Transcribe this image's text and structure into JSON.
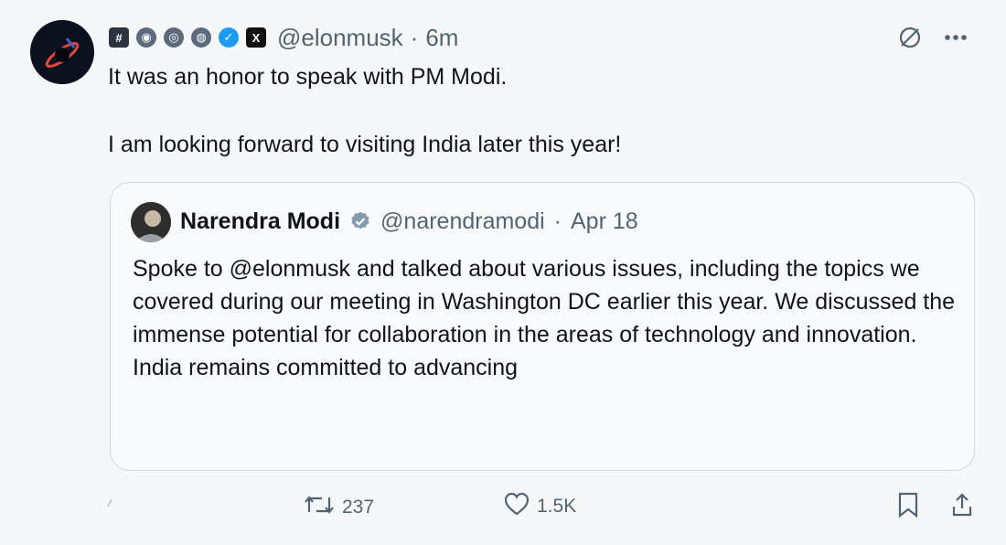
{
  "tweet": {
    "author_handle": "@elonmusk",
    "separator": "·",
    "time": "6m",
    "text_line1": "It was an honor to speak with PM Modi.",
    "text_line2": "I am looking forward to visiting India later this year!",
    "badges": [
      "hash-badge",
      "community-badge",
      "community-badge",
      "community-badge",
      "verified-badge",
      "x-logo-badge"
    ],
    "icons": {
      "grok": "grok-icon",
      "more": "more-icon"
    }
  },
  "quote": {
    "name": "Narendra Modi",
    "handle": "@narendramodi",
    "separator": "·",
    "date": "Apr 18",
    "text": "Spoke to @elonmusk and talked about various issues, including the topics we covered during our meeting in Washington DC earlier this year. We discussed the immense potential for collaboration in the areas of technology and innovation. India remains committed to advancing",
    "verified_color": "#829aab"
  },
  "actions": {
    "retweets": "237",
    "likes": "1.5K"
  },
  "colors": {
    "text": "#0f1419",
    "muted": "#536471",
    "border": "#cfd9de",
    "background": "#f6f7f8"
  }
}
